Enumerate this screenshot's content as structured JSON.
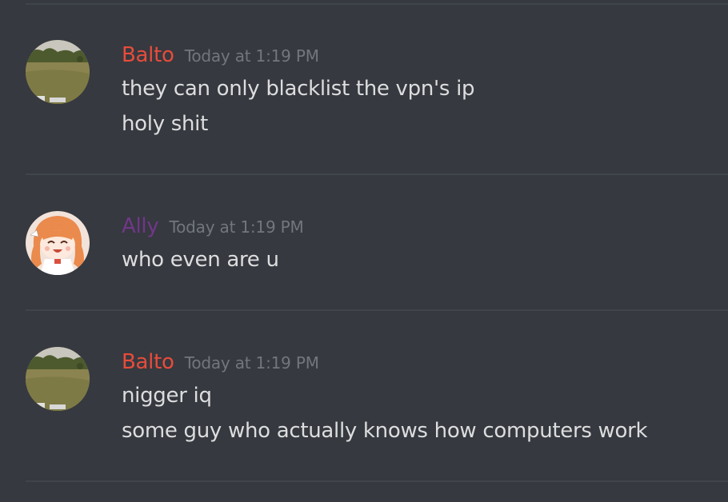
{
  "colors": {
    "background": "#36393f",
    "divider": "#40444b",
    "text": "#dcddde",
    "timestamp": "#72767d",
    "balto": "#e74c3c",
    "ally": "#71368a"
  },
  "messages": [
    {
      "author": "Balto",
      "author_color": "#e74c3c",
      "avatar_icon": "grass-field-avatar-icon",
      "timestamp": "Today at 1:19 PM",
      "lines": [
        "they can only blacklist the vpn's ip",
        "holy shit"
      ]
    },
    {
      "author": "Ally",
      "author_color": "#71368a",
      "avatar_icon": "anime-girl-avatar-icon",
      "timestamp": "Today at 1:19 PM",
      "lines": [
        "who even are u"
      ]
    },
    {
      "author": "Balto",
      "author_color": "#e74c3c",
      "avatar_icon": "grass-field-avatar-icon",
      "timestamp": "Today at 1:19 PM",
      "lines": [
        "nigger iq",
        "some guy who actually knows how computers work"
      ]
    }
  ]
}
